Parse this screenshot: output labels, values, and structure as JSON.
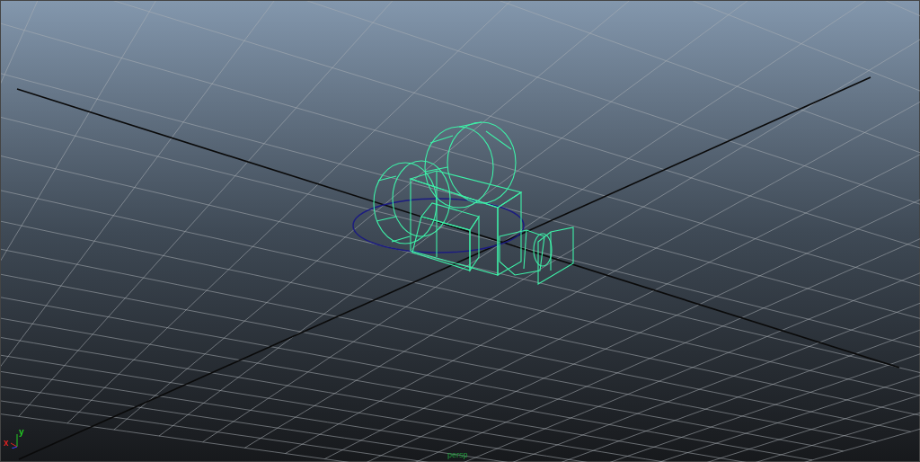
{
  "viewport": {
    "camera_label": "persp",
    "axis_labels": [
      {
        "axis": "y",
        "color": "#22cc22"
      },
      {
        "axis": "x",
        "color": "#dd2222"
      }
    ]
  }
}
